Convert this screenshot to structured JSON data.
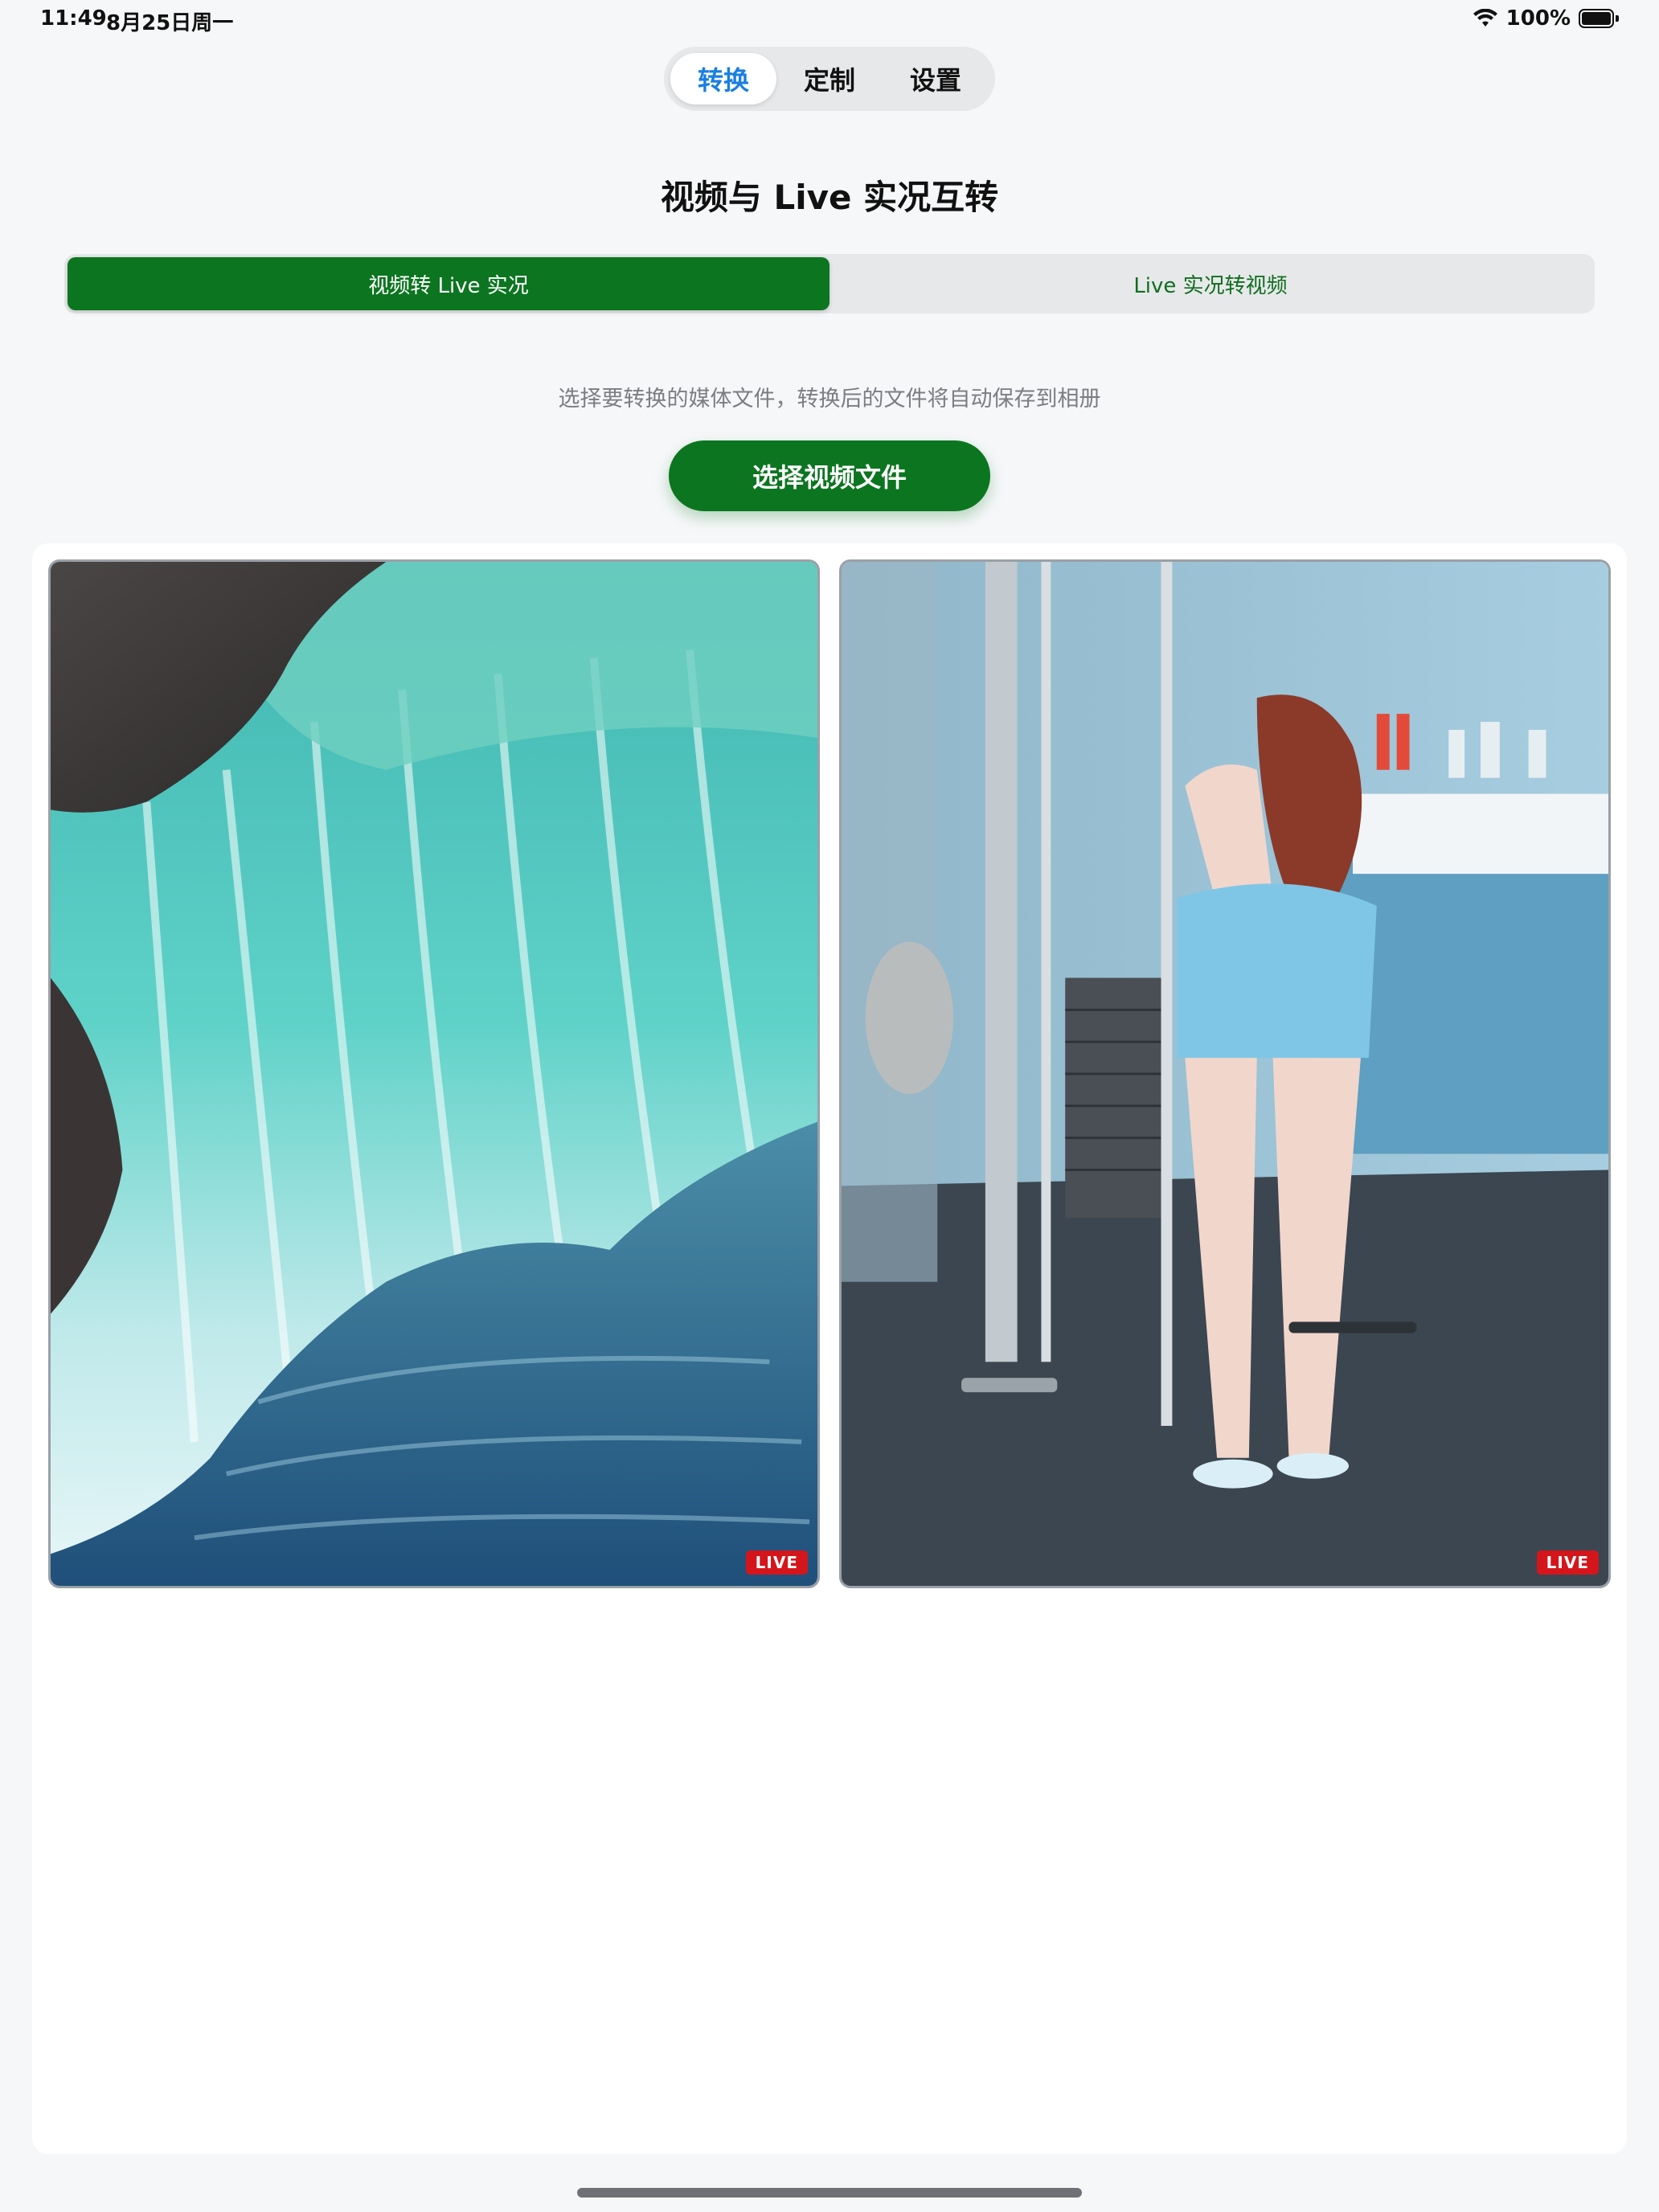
{
  "status_bar": {
    "time": "11:49",
    "date": "8月25日周一",
    "battery": "100%"
  },
  "top_tabs": [
    {
      "label": "转换",
      "active": true
    },
    {
      "label": "定制",
      "active": false
    },
    {
      "label": "设置",
      "active": false
    }
  ],
  "title": "视频与 Live 实况互转",
  "mode_tabs": [
    {
      "label": "视频转 Live 实况",
      "active": true
    },
    {
      "label": "Live 实况转视频",
      "active": false
    }
  ],
  "hint": "选择要转换的媒体文件，转换后的文件将自动保存到相册",
  "select_button": "选择视频文件",
  "gallery": {
    "items": [
      {
        "subject": "waterfall",
        "badge": "LIVE"
      },
      {
        "subject": "gym-person",
        "badge": "LIVE"
      }
    ]
  },
  "colors": {
    "accent_green": "#0c7520",
    "active_tab_blue": "#1a7fe0",
    "live_red": "#d4161c"
  }
}
